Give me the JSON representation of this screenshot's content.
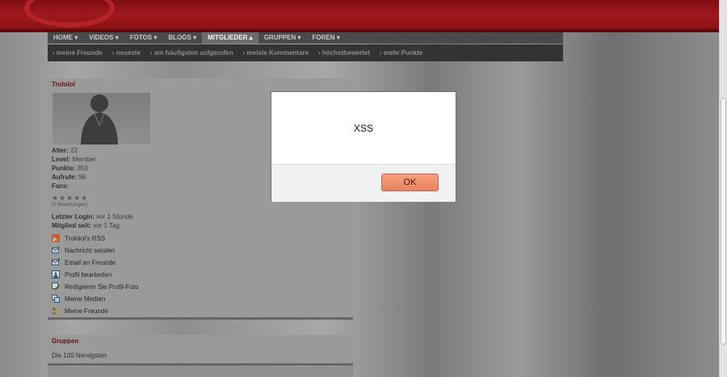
{
  "nav": {
    "items": [
      {
        "label": "HOME",
        "active": false
      },
      {
        "label": "VIDEOS",
        "active": false
      },
      {
        "label": "FOTOS",
        "active": false
      },
      {
        "label": "BLOGS",
        "active": false
      },
      {
        "label": "MITGLIEDER",
        "active": true
      },
      {
        "label": "GRUPPEN",
        "active": false
      },
      {
        "label": "FOREN",
        "active": false
      }
    ]
  },
  "subnav": {
    "items": [
      "meine Freunde",
      "neueste",
      "am häufigsten aufgerufen",
      "meiste Kommentare",
      "höchstbewertet",
      "mehr Punkte"
    ]
  },
  "profile": {
    "name": "Trololol",
    "stats": [
      {
        "label": "Alter:",
        "value": "22"
      },
      {
        "label": "Level:",
        "value": "Member"
      },
      {
        "label": "Punkte:",
        "value": "350"
      },
      {
        "label": "Aufrufe:",
        "value": "96"
      },
      {
        "label": "Fans:",
        "value": ""
      }
    ],
    "rating_stars": "★★★★★",
    "rating_count": "(0 Bewertungen)",
    "last_login_label": "Letzter Login:",
    "last_login_value": "vor 1 Stunde",
    "member_since_label": "Mitglied seit:",
    "member_since_value": "vor 1 Tag",
    "actions": [
      {
        "label": "Trololol's RSS",
        "icon": "rss-icon"
      },
      {
        "label": "Nachricht senden",
        "icon": "message-icon"
      },
      {
        "label": "Email an Freunde",
        "icon": "email-icon"
      },
      {
        "label": "Profil bearbeiten",
        "icon": "edit-profile-icon"
      },
      {
        "label": "Redigieren Sie Profil-Foto",
        "icon": "photo-edit-icon"
      },
      {
        "label": "Meine Medien",
        "icon": "media-icon"
      },
      {
        "label": "Meine Freunde",
        "icon": "friends-icon"
      }
    ]
  },
  "groups": {
    "title": "Gruppen",
    "item": "Die 100 Nervigsten"
  },
  "dialog": {
    "message": "XSS",
    "ok_label": "OK"
  }
}
